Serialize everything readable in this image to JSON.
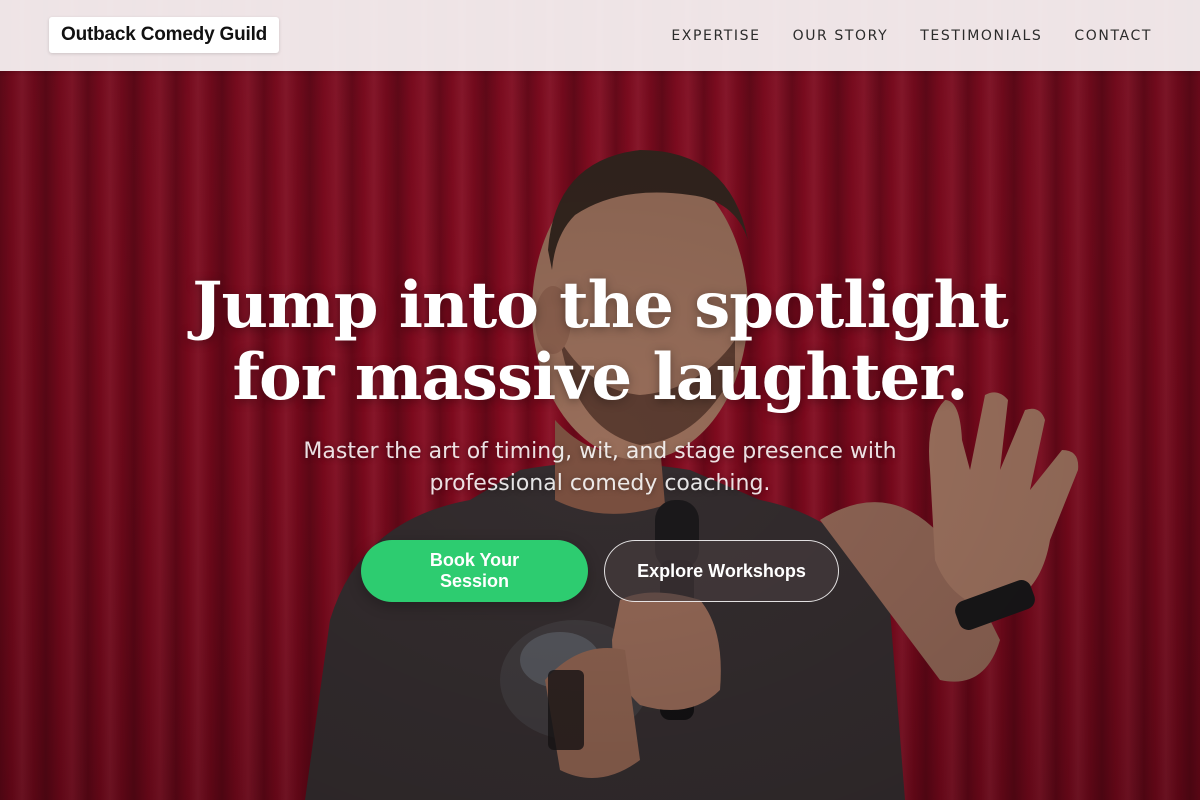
{
  "header": {
    "brand": "Outback Comedy Guild",
    "nav": [
      {
        "label": "EXPERTISE"
      },
      {
        "label": "OUR STORY"
      },
      {
        "label": "TESTIMONIALS"
      },
      {
        "label": "CONTACT"
      }
    ]
  },
  "hero": {
    "headline_line1": "Jump into the spotlight",
    "headline_line2": "for massive laughter.",
    "subheadline": "Master the art of timing, wit, and stage presence with professional comedy coaching.",
    "primary_cta": "Book Your Session",
    "secondary_cta": "Explore Workshops",
    "background": "comedian-on-stage-red-curtain"
  },
  "colors": {
    "header_bg": "#f6f0f1",
    "curtain_red": "#9a0c24",
    "primary_button": "#2dcc70",
    "text_light": "#ffffff",
    "nav_text": "#2b2b2b"
  }
}
